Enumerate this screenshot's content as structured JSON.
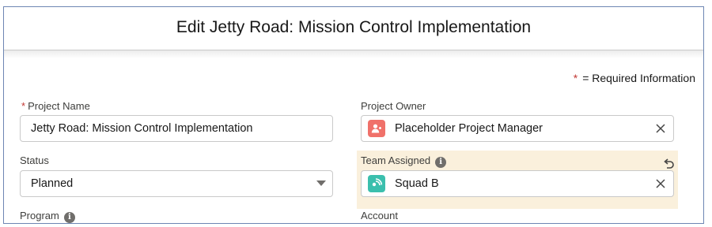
{
  "modal": {
    "title": "Edit Jetty Road: Mission Control Implementation"
  },
  "required_note": {
    "star": "*",
    "text": "= Required Information"
  },
  "fields": {
    "project_name": {
      "required_star": "*",
      "label": "Project Name",
      "value": "Jetty Road: Mission Control Implementation"
    },
    "project_owner": {
      "label": "Project Owner",
      "value": "Placeholder Project Manager",
      "icon": "user-icon",
      "icon_color": "#f0716a"
    },
    "status": {
      "label": "Status",
      "value": "Planned"
    },
    "team_assigned": {
      "label": "Team Assigned",
      "value": "Squad B",
      "icon": "team-icon",
      "icon_color": "#3bbfad",
      "highlight_color": "#faf0dc"
    },
    "program": {
      "label": "Program"
    },
    "account": {
      "label": "Account"
    }
  }
}
